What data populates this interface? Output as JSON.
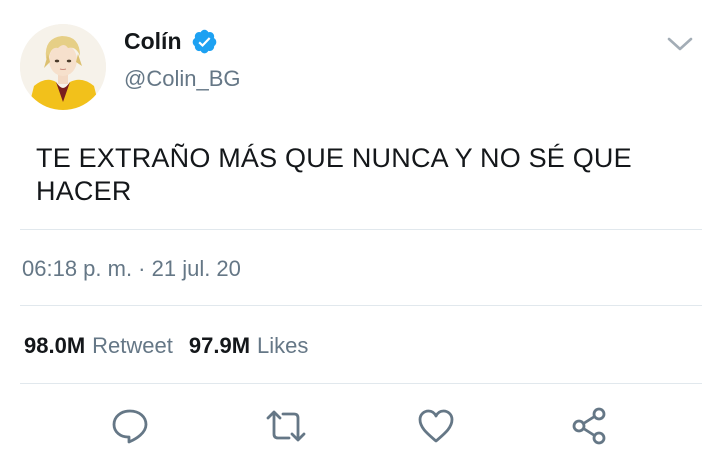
{
  "user": {
    "display_name": "Colín",
    "handle": "@Colin_BG",
    "verified": true
  },
  "tweet": {
    "text_line1": "TE EXTRAÑO MÁS QUE NUNCA Y NO SÉ QUE",
    "text_line2": "HACER",
    "timestamp": "06:18 p. m. · 21 jul. 20"
  },
  "stats": {
    "retweets_count": "98.0M",
    "retweets_label": "Retweet",
    "likes_count": "97.9M",
    "likes_label": "Likes"
  },
  "icons": {
    "verified": "verified-badge-icon",
    "menu": "chevron-down-icon",
    "reply": "reply-icon",
    "retweet": "retweet-icon",
    "like": "heart-icon",
    "share": "share-icon"
  },
  "colors": {
    "text_primary": "#14171a",
    "text_secondary": "#657786",
    "verified_blue": "#1da1f2",
    "divider": "#e1e8ed"
  }
}
